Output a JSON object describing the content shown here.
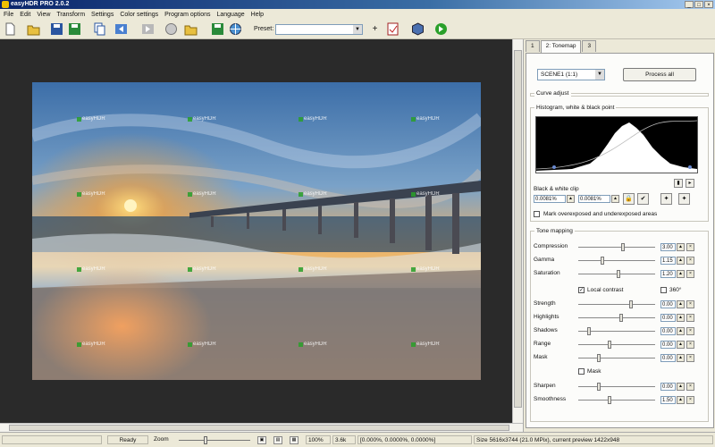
{
  "window": {
    "title": "easyHDR PRO 2.0.2",
    "controls": [
      "_",
      "□",
      "×"
    ]
  },
  "menu": [
    "File",
    "Edit",
    "View",
    "Transform",
    "Settings",
    "Color settings",
    "Program options",
    "Language",
    "Help"
  ],
  "toolbar": {
    "buttons": [
      "new-icon",
      "open-icon",
      "save-icon",
      "save-as-icon",
      "copy-icon",
      "back-icon",
      "forward-icon",
      "batch-icon",
      "open-folder-icon",
      "export-icon",
      "web-icon",
      "print-icon",
      "3d-icon",
      "go-icon"
    ],
    "preset_label": "Preset:",
    "preset_value": "",
    "add_label": "+"
  },
  "watermark": {
    "text": "easyHDR"
  },
  "panel": {
    "tabs": [
      "1",
      "2: Tonemap",
      "3"
    ],
    "active_tab": 1,
    "profile_value": "SCENE1 (1:1)",
    "process_label": "Process all",
    "curve_group_title": "Curve adjust",
    "histogram_group_title": "Histogram, white & black point",
    "bw_label": "Black & white clip",
    "black_clip": "0.0081%",
    "white_clip": "0.0081%",
    "mark_label": "Mark overexposed and underexposed areas",
    "tone_group_title": "Tone mapping",
    "sliders_top": [
      {
        "label": "Compression",
        "value": "3.00",
        "level": 0.58
      },
      {
        "label": "Gamma",
        "value": "1.15",
        "level": 0.3
      },
      {
        "label": "Saturation",
        "value": "1.20",
        "level": 0.52
      }
    ],
    "local_contrast_label": "Local contrast",
    "local_contrast_checked": true,
    "deg_label": "360°",
    "deg_checked": false,
    "sliders_mid": [
      {
        "label": "Strength",
        "value": "0.00",
        "level": 0.7
      },
      {
        "label": "Highlights",
        "value": "0.00",
        "level": 0.56
      },
      {
        "label": "Shadows",
        "value": "0.00",
        "level": 0.12
      },
      {
        "label": "Range",
        "value": "0.00",
        "level": 0.4
      },
      {
        "label": "Mask",
        "value": "0.00",
        "level": 0.25
      }
    ],
    "mask_label": "Mask",
    "mask_checked": false,
    "sliders_bottom": [
      {
        "label": "Sharpen",
        "value": "0.00",
        "level": 0.25
      },
      {
        "label": "Smoothness",
        "value": "1.50",
        "level": 0.4
      }
    ]
  },
  "status": {
    "ready": "Ready",
    "zoom_label": "Zoom",
    "zoom_value": "100%",
    "size": "3.6k",
    "coords": "[0.000%, 0.0000%, 0.0000%]",
    "info": "Size 5616x3744 (21.0 MPix), current preview 1422x948"
  },
  "colors": {
    "accent": "#0a246a",
    "panel_bg": "#fcfcfa"
  }
}
